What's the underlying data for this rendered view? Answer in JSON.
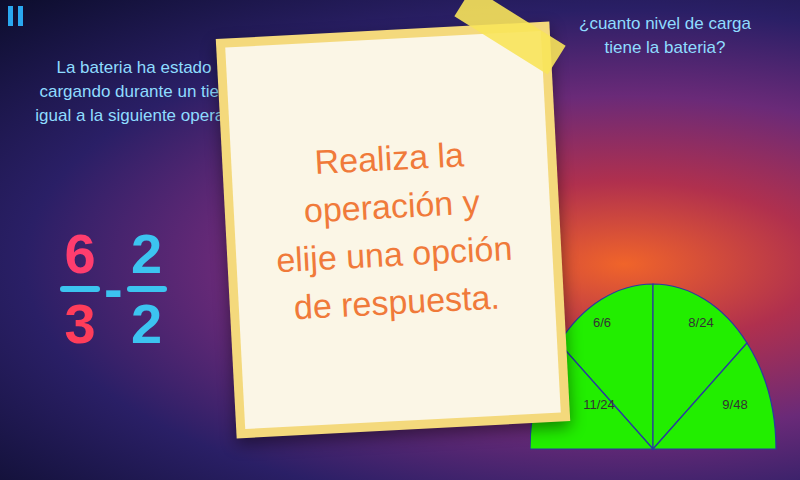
{
  "story": {
    "lines": [
      "La bateria ha estado",
      "cargando durante un tien",
      "igual a la siguiente operac"
    ]
  },
  "operation": {
    "left": {
      "numerator": "6",
      "denominator": "3"
    },
    "operator": "-",
    "right": {
      "numerator": "2",
      "denominator": "2"
    }
  },
  "note": {
    "lines": [
      "Realiza la",
      "operación y",
      "elije una opción",
      "de respuesta."
    ]
  },
  "question": {
    "lines": [
      "¿cuanto nivel de carga",
      "tiene la bateria?"
    ]
  },
  "options": [
    {
      "label": "6/6",
      "selected": false
    },
    {
      "label": "8/24",
      "selected": false
    },
    {
      "label": "11/24",
      "selected": false
    },
    {
      "label": "9/48",
      "selected": false
    }
  ]
}
